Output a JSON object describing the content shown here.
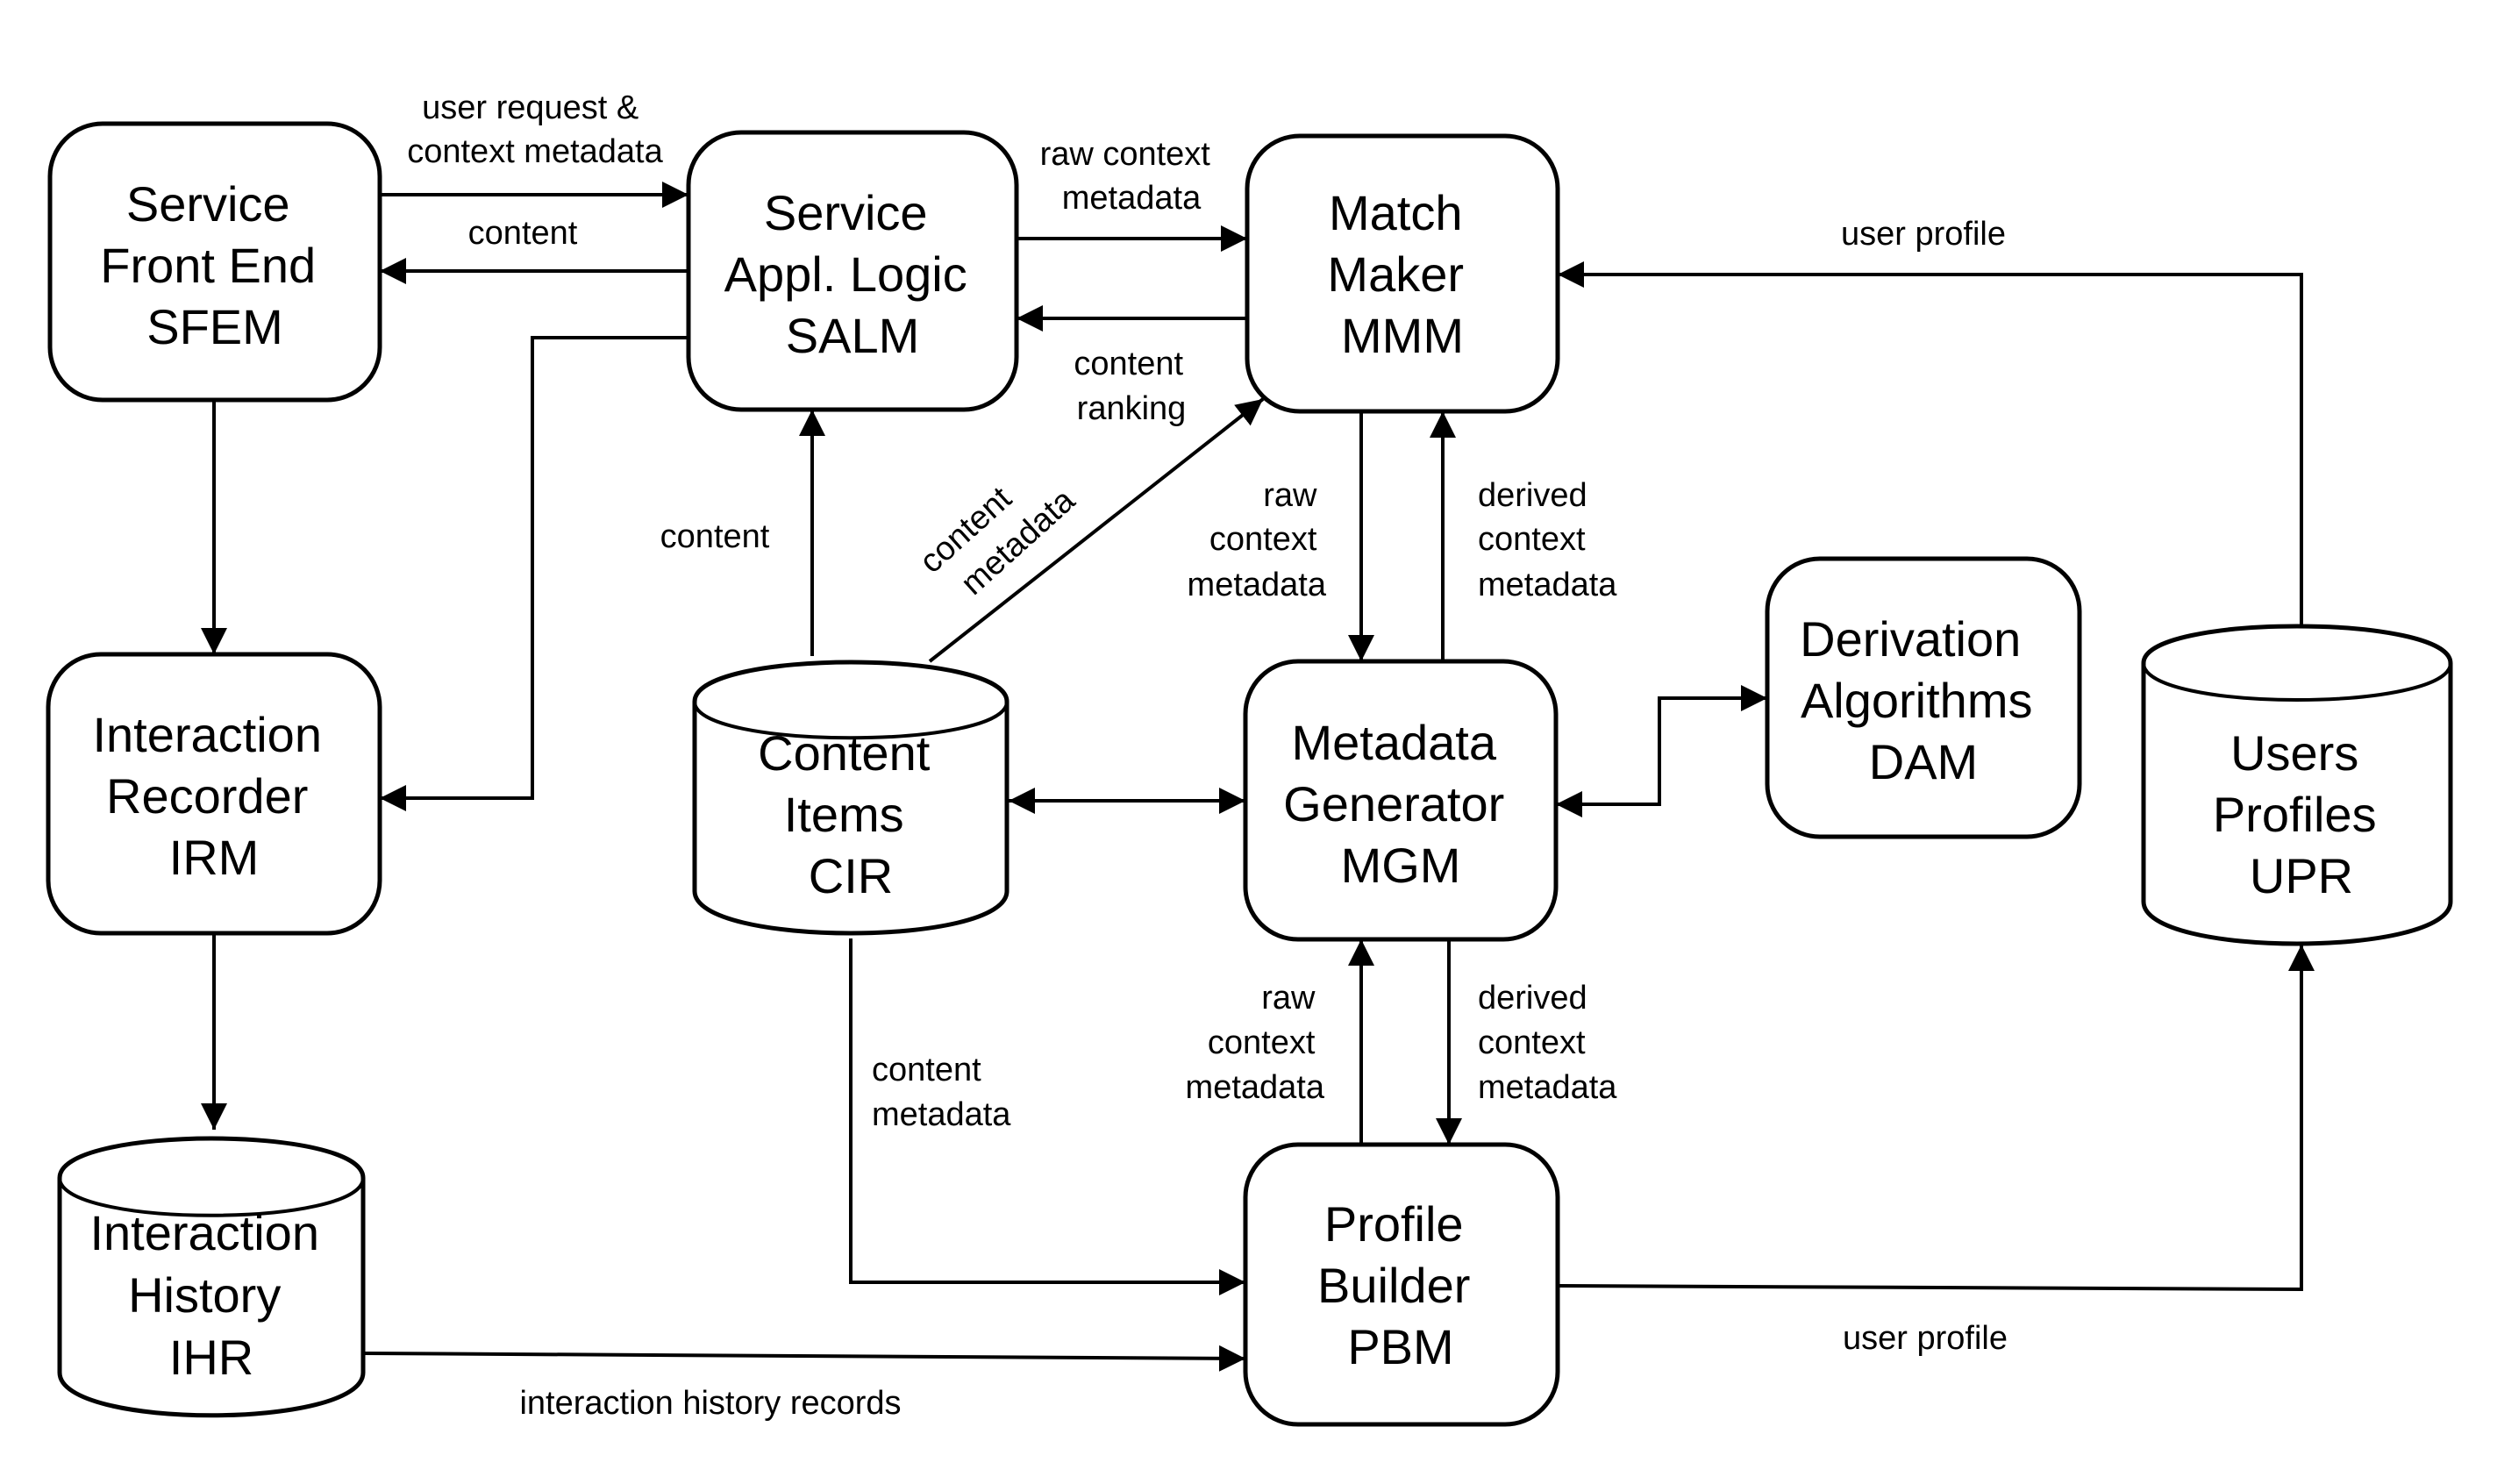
{
  "diagram": {
    "colors": {
      "stroke": "#000000",
      "background": "#ffffff"
    },
    "nodes": {
      "sfem": {
        "kind": "module",
        "lines": [
          "Service",
          "Front End",
          "SFEM"
        ]
      },
      "salm": {
        "kind": "module",
        "lines": [
          "Service",
          "Appl. Logic",
          "SALM"
        ]
      },
      "mmm": {
        "kind": "module",
        "lines": [
          "Match",
          "Maker",
          "MMM"
        ]
      },
      "irm": {
        "kind": "module",
        "lines": [
          "Interaction",
          "Recorder",
          "IRM"
        ]
      },
      "cir": {
        "kind": "repository",
        "lines": [
          "Content",
          "Items",
          "CIR"
        ]
      },
      "mgm": {
        "kind": "module",
        "lines": [
          "Metadata",
          "Generator",
          "MGM"
        ]
      },
      "dam": {
        "kind": "module",
        "lines": [
          "Derivation",
          "Algorithms",
          "DAM"
        ]
      },
      "upr": {
        "kind": "repository",
        "lines": [
          "Users",
          "Profiles",
          "UPR"
        ]
      },
      "ihr": {
        "kind": "repository",
        "lines": [
          "Interaction",
          "History",
          "IHR"
        ]
      },
      "pbm": {
        "kind": "module",
        "lines": [
          "Profile",
          "Builder",
          "PBM"
        ]
      }
    },
    "edges": [
      {
        "id": "sfem-salm-request",
        "from": "SFEM",
        "to": "SALM",
        "lines": [
          "user request &",
          "context metadata"
        ]
      },
      {
        "id": "salm-sfem-content",
        "from": "SALM",
        "to": "SFEM",
        "lines": [
          "content"
        ]
      },
      {
        "id": "salm-irm",
        "from": "SALM",
        "to": "IRM",
        "lines": []
      },
      {
        "id": "sfem-irm",
        "from": "SFEM",
        "to": "IRM",
        "lines": []
      },
      {
        "id": "salm-mmm-raw",
        "from": "SALM",
        "to": "MMM",
        "lines": [
          "raw context",
          "metadata"
        ]
      },
      {
        "id": "mmm-salm-ranking",
        "from": "MMM",
        "to": "SALM",
        "lines": [
          "content",
          "ranking"
        ]
      },
      {
        "id": "upr-mmm-profile",
        "from": "UPR",
        "to": "MMM",
        "lines": [
          "user profile"
        ]
      },
      {
        "id": "cir-salm-content",
        "from": "CIR",
        "to": "SALM",
        "lines": [
          "content"
        ]
      },
      {
        "id": "cir-mmm-metadata",
        "from": "CIR",
        "to": "MMM",
        "lines": [
          "content",
          "metadata"
        ]
      },
      {
        "id": "mmm-mgm-raw",
        "from": "MMM",
        "to": "MGM",
        "lines": [
          "raw",
          "context",
          "metadata"
        ]
      },
      {
        "id": "mgm-mmm-derived",
        "from": "MGM",
        "to": "MMM",
        "lines": [
          "derived",
          "context",
          "metadata"
        ]
      },
      {
        "id": "cir-mgm",
        "from": "CIR",
        "to": "MGM",
        "lines": [],
        "bidirectional": true
      },
      {
        "id": "mgm-dam",
        "from": "MGM",
        "to": "DAM",
        "lines": [],
        "bidirectional": true
      },
      {
        "id": "irm-ihr",
        "from": "IRM",
        "to": "IHR",
        "lines": []
      },
      {
        "id": "pbm-mgm-raw",
        "from": "PBM",
        "to": "MGM",
        "lines": [
          "raw",
          "context",
          "metadata"
        ]
      },
      {
        "id": "mgm-pbm-derived",
        "from": "MGM",
        "to": "PBM",
        "lines": [
          "derived",
          "context",
          "metadata"
        ]
      },
      {
        "id": "cir-pbm-metadata",
        "from": "CIR",
        "to": "PBM",
        "lines": [
          "content",
          "metadata"
        ]
      },
      {
        "id": "ihr-pbm-records",
        "from": "IHR",
        "to": "PBM",
        "lines": [
          "interaction history records"
        ]
      },
      {
        "id": "pbm-upr-profile",
        "from": "PBM",
        "to": "UPR",
        "lines": [
          "user profile"
        ]
      }
    ]
  }
}
